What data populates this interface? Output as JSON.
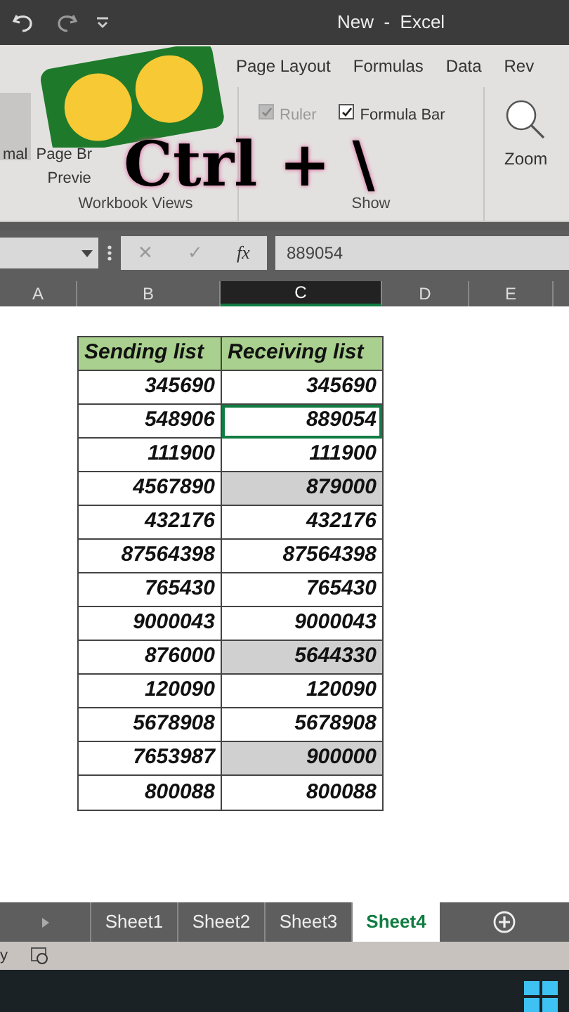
{
  "window": {
    "title": "New  -  Excel"
  },
  "ribbon_tabs": [
    {
      "label": "Page Layout",
      "selected": false
    },
    {
      "label": "Formulas",
      "selected": false
    },
    {
      "label": "Data",
      "selected": false
    },
    {
      "label": "Rev",
      "selected": false
    }
  ],
  "ribbon": {
    "workbook_views": {
      "items": [
        "mal",
        "Page Br",
        "Previe"
      ],
      "group_label": "Workbook Views"
    },
    "show": {
      "checkboxes": [
        {
          "label": "Ruler",
          "checked": true,
          "disabled": true
        },
        {
          "label": "Formula Bar",
          "checked": true,
          "disabled": false
        }
      ],
      "group_label": "Show"
    },
    "zoom": {
      "label": "Zoom"
    }
  },
  "overlay": {
    "text": "Ctrl + \\"
  },
  "formula_bar": {
    "cancel": "✕",
    "enter": "✓",
    "fx": "fx",
    "value": "889054"
  },
  "columns": [
    {
      "label": "A",
      "selected": false
    },
    {
      "label": "B",
      "selected": false
    },
    {
      "label": "C",
      "selected": true
    },
    {
      "label": "D",
      "selected": false
    },
    {
      "label": "E",
      "selected": false
    }
  ],
  "table": {
    "headers": [
      "Sending list",
      "Receiving list"
    ],
    "rows": [
      {
        "sending": "345690",
        "receiving": "345690",
        "highlighted": false,
        "selected": false
      },
      {
        "sending": "548906",
        "receiving": "889054",
        "highlighted": false,
        "selected": true
      },
      {
        "sending": "111900",
        "receiving": "111900",
        "highlighted": false,
        "selected": false
      },
      {
        "sending": "4567890",
        "receiving": "879000",
        "highlighted": true,
        "selected": false
      },
      {
        "sending": "432176",
        "receiving": "432176",
        "highlighted": false,
        "selected": false
      },
      {
        "sending": "87564398",
        "receiving": "87564398",
        "highlighted": false,
        "selected": false
      },
      {
        "sending": "765430",
        "receiving": "765430",
        "highlighted": false,
        "selected": false
      },
      {
        "sending": "9000043",
        "receiving": "9000043",
        "highlighted": false,
        "selected": false
      },
      {
        "sending": "876000",
        "receiving": "5644330",
        "highlighted": true,
        "selected": false
      },
      {
        "sending": "120090",
        "receiving": "120090",
        "highlighted": false,
        "selected": false
      },
      {
        "sending": "5678908",
        "receiving": "5678908",
        "highlighted": false,
        "selected": false
      },
      {
        "sending": "7653987",
        "receiving": "900000",
        "highlighted": true,
        "selected": false
      },
      {
        "sending": "800088",
        "receiving": "800088",
        "highlighted": false,
        "selected": false
      }
    ]
  },
  "sheet_tabs": [
    {
      "label": "Sheet1",
      "selected": false
    },
    {
      "label": "Sheet2",
      "selected": false
    },
    {
      "label": "Sheet3",
      "selected": false
    },
    {
      "label": "Sheet4",
      "selected": true
    }
  ],
  "status_bar": {
    "text": "y"
  }
}
